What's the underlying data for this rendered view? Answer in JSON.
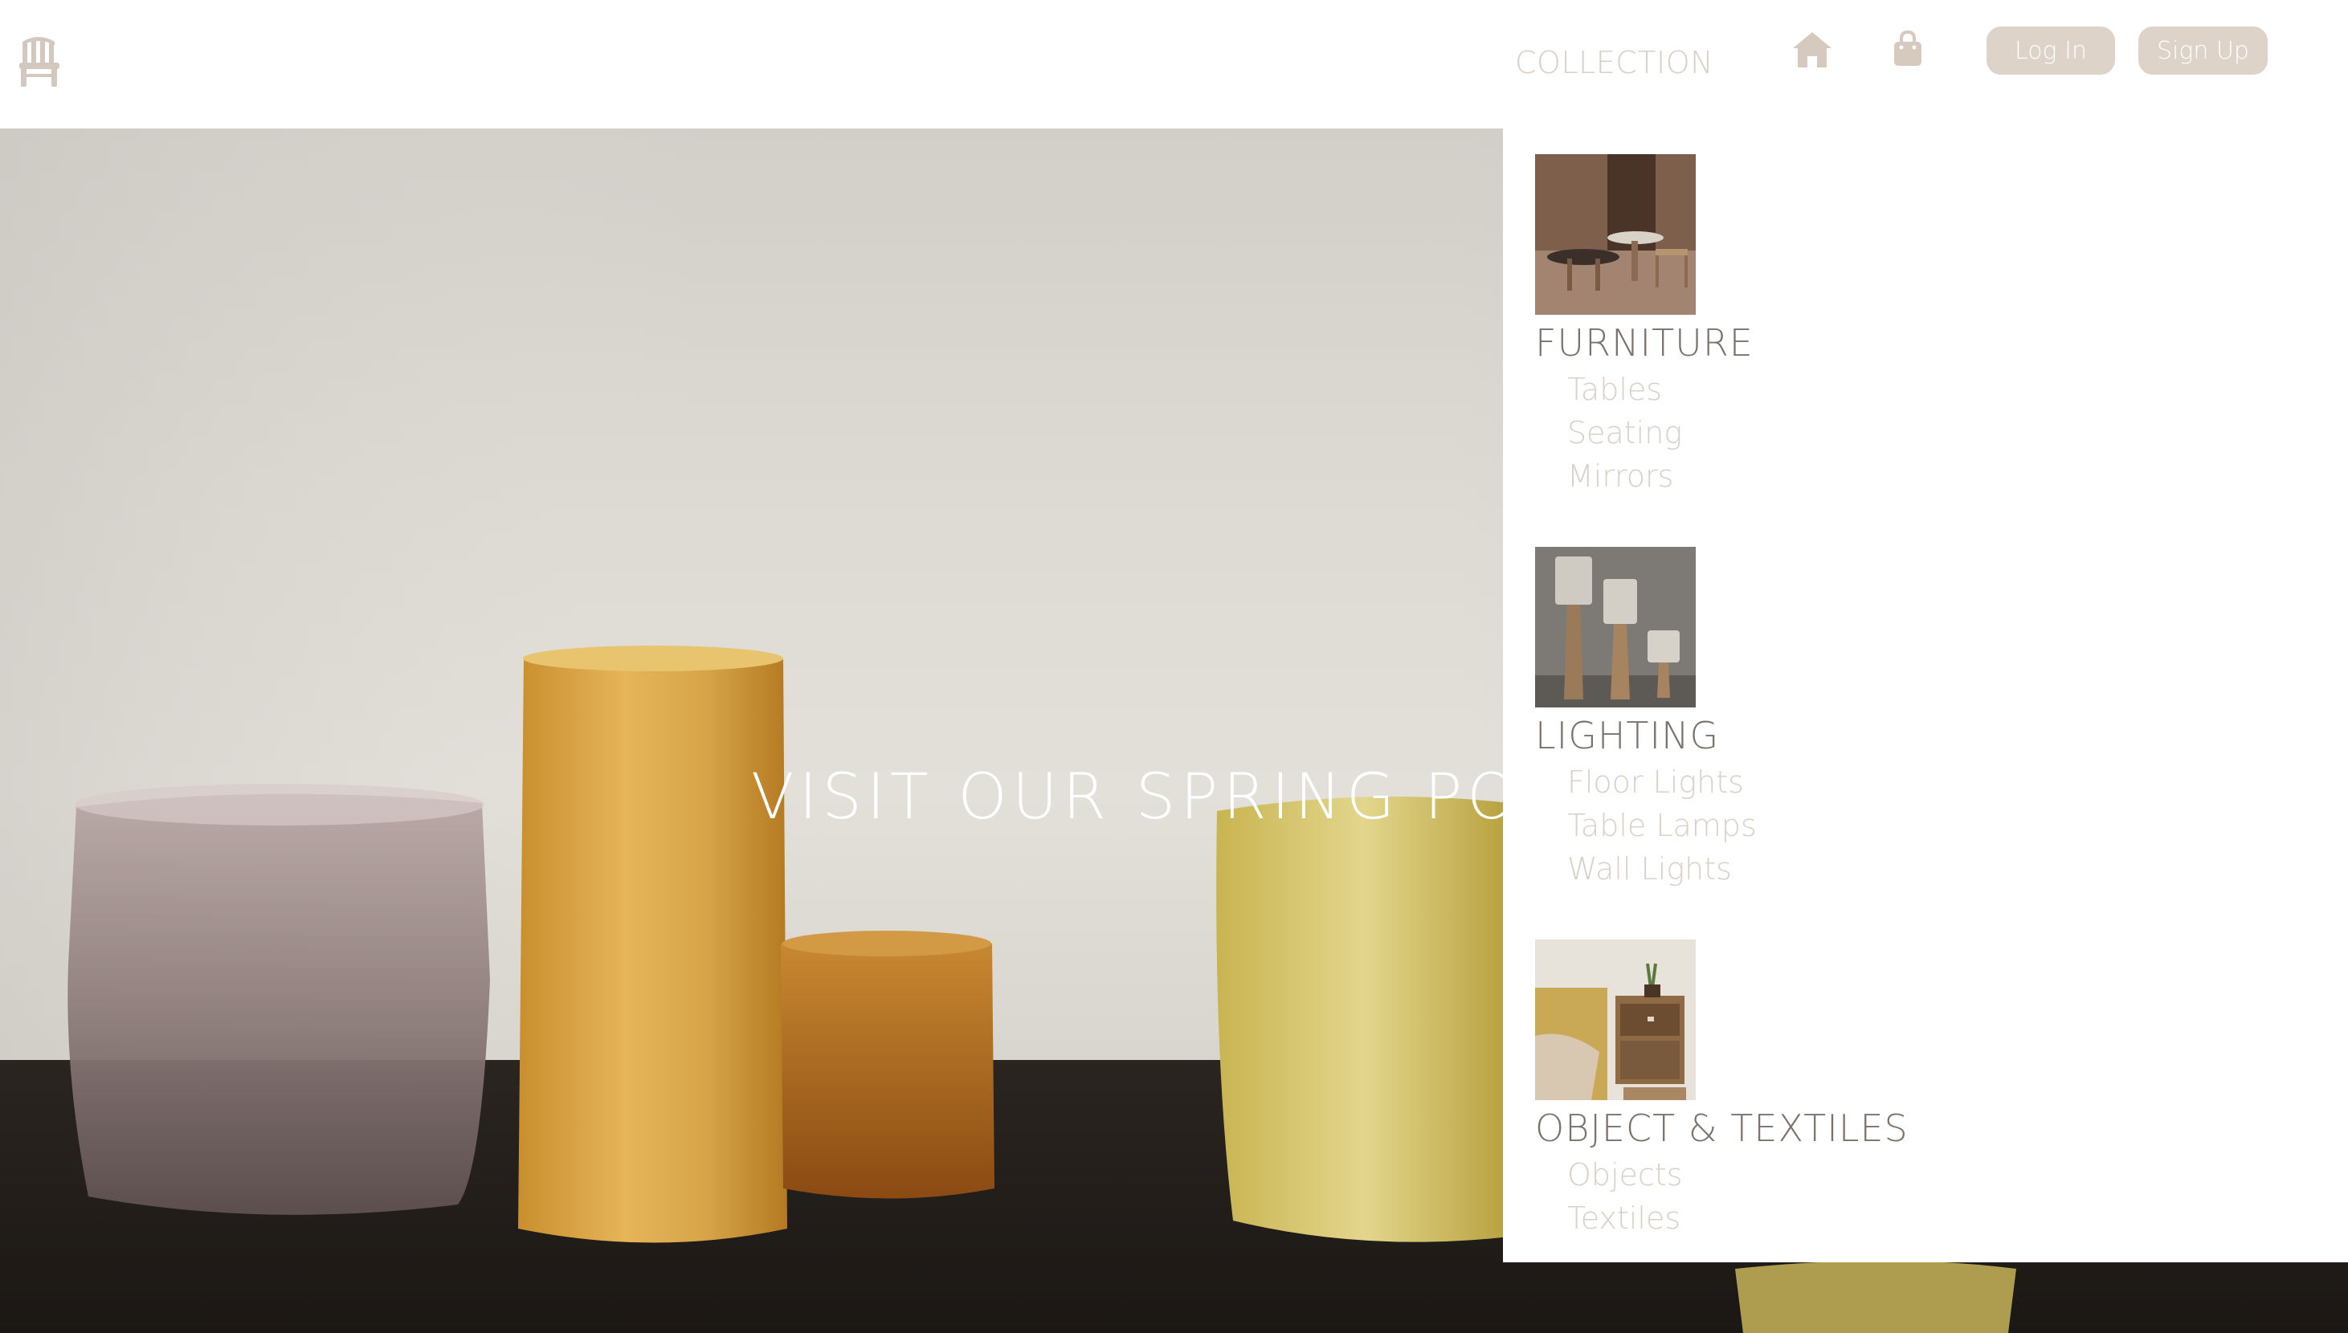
{
  "header": {
    "logo_icon": "chair-icon",
    "nav_collection": "COLLECTION",
    "home_icon": "home-icon",
    "cart_icon": "shopping-bag-icon",
    "login_label": "Log In",
    "signup_label": "Sign Up",
    "accent_color": "#ddd3c8"
  },
  "hero": {
    "title": "VISIT OUR SPRING POP-"
  },
  "menu": {
    "categories": [
      {
        "title": "FURNITURE",
        "items": [
          "Tables",
          "Seating",
          "Mirrors"
        ]
      },
      {
        "title": "LIGHTING",
        "items": [
          "Floor Lights",
          "Table Lamps",
          "Wall Lights"
        ]
      },
      {
        "title": "OBJECT & TEXTILES",
        "items": [
          "Objects",
          "Textiles"
        ]
      }
    ]
  }
}
